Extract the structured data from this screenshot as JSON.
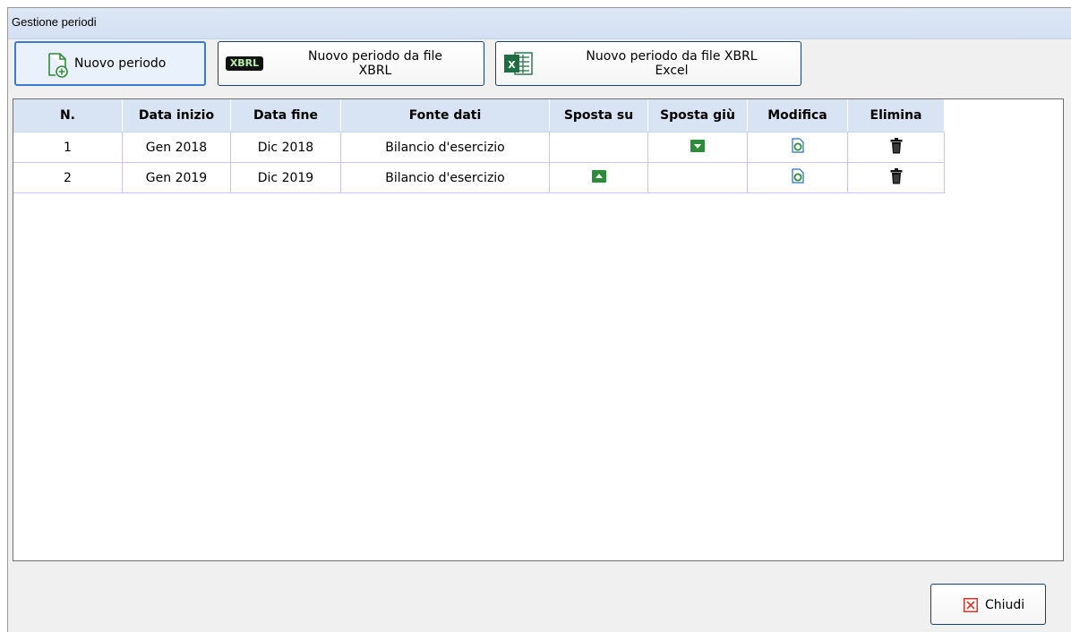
{
  "window": {
    "title": "Gestione periodi"
  },
  "toolbar": {
    "new_period": {
      "label": "Nuovo periodo",
      "icon": "new-document-icon"
    },
    "new_from_xbrl": {
      "label_line1": "Nuovo periodo da file",
      "label_line2": "XBRL",
      "icon": "xbrl-icon",
      "icon_text": "XBRL"
    },
    "new_from_xbrl_excel": {
      "label_line1": "Nuovo periodo da file XBRL",
      "label_line2": "Excel",
      "icon": "excel-icon",
      "icon_text": "X"
    }
  },
  "table": {
    "columns": [
      "N.",
      "Data inizio",
      "Data fine",
      "Fonte dati",
      "Sposta su",
      "Sposta giù",
      "Modifica",
      "Elimina"
    ],
    "rows": [
      {
        "n": "1",
        "start": "Gen 2018",
        "end": "Dic 2018",
        "source": "Bilancio d'esercizio",
        "move_up": false,
        "move_down": true
      },
      {
        "n": "2",
        "start": "Gen 2019",
        "end": "Dic 2019",
        "source": "Bilancio d'esercizio",
        "move_up": true,
        "move_down": false
      }
    ]
  },
  "footer": {
    "close_label": "Chiudi",
    "close_icon": "close-icon"
  },
  "colors": {
    "header_bg": "#d8e4f4",
    "green": "#2e8b3a",
    "close_red": "#d9342b",
    "title_bar": "#d6e2f3"
  }
}
